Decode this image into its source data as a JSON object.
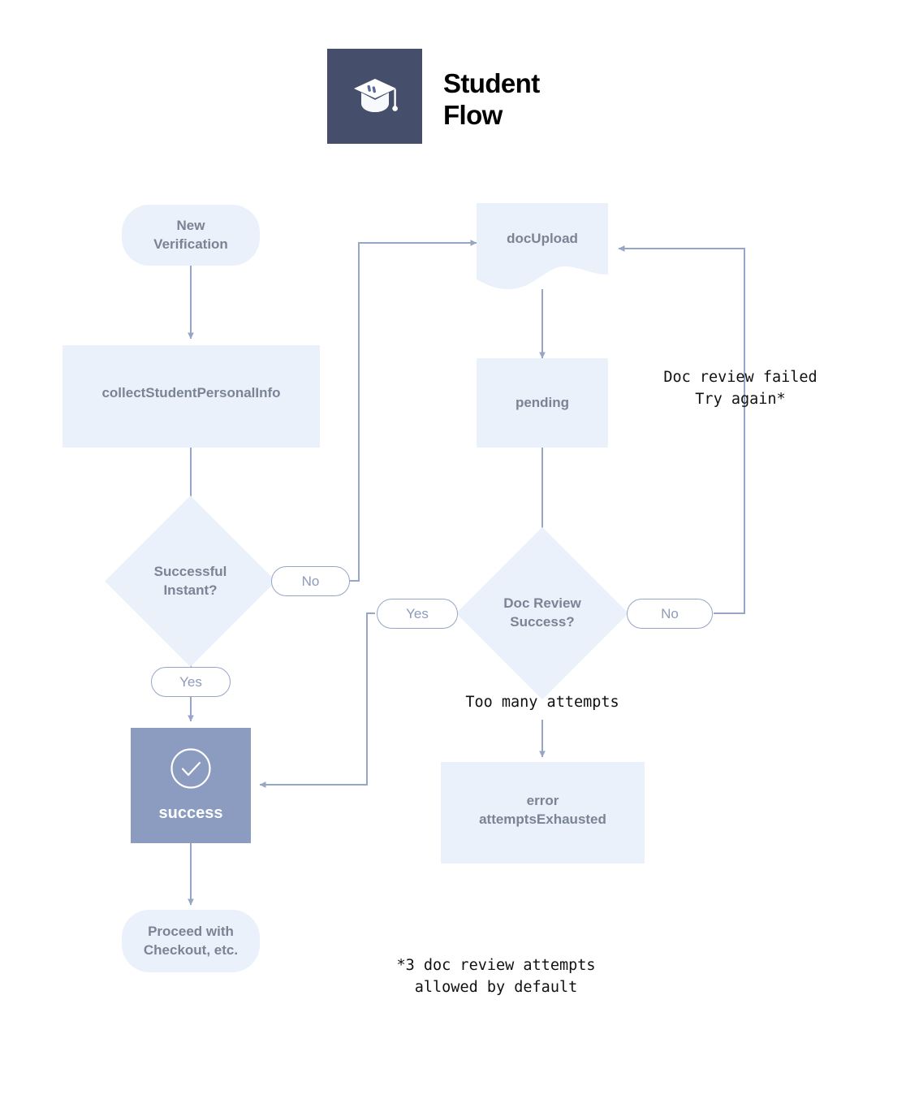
{
  "header": {
    "title": "Student\nFlow",
    "logo_icon": "graduation-cap-icon",
    "logo_bg": "#454f6b"
  },
  "colors": {
    "node_fill": "#eaf1fb",
    "node_text": "#7b8494",
    "success_fill": "#8c9cc0",
    "success_text": "#ffffff",
    "edge_stroke": "#97a5c6",
    "pill_text": "#8e9bbb",
    "annotation_text": "#111111",
    "background": "#ffffff"
  },
  "chart_data": {
    "type": "diagram",
    "title": "Student Flow",
    "nodes": [
      {
        "id": "new_verification",
        "label": "New\nVerification",
        "shape": "rounded-terminal"
      },
      {
        "id": "collect_info",
        "label": "collectStudentPersonalInfo",
        "shape": "rectangle"
      },
      {
        "id": "successful_instant",
        "label": "Successful\nInstant?",
        "shape": "diamond"
      },
      {
        "id": "success",
        "label": "success",
        "shape": "rectangle-filled",
        "icon": "check-circle-icon"
      },
      {
        "id": "proceed",
        "label": "Proceed with\nCheckout, etc.",
        "shape": "rounded-terminal"
      },
      {
        "id": "doc_upload",
        "label": "docUpload",
        "shape": "document"
      },
      {
        "id": "pending",
        "label": "pending",
        "shape": "rectangle"
      },
      {
        "id": "doc_review",
        "label": "Doc Review\nSuccess?",
        "shape": "diamond"
      },
      {
        "id": "error",
        "label": "error\nattemptsExhausted",
        "shape": "rectangle"
      }
    ],
    "edges": [
      {
        "from": "new_verification",
        "to": "collect_info",
        "label": ""
      },
      {
        "from": "collect_info",
        "to": "successful_instant",
        "label": ""
      },
      {
        "from": "successful_instant",
        "to": "success",
        "label": "Yes"
      },
      {
        "from": "successful_instant",
        "to": "doc_upload",
        "label": "No"
      },
      {
        "from": "success",
        "to": "proceed",
        "label": ""
      },
      {
        "from": "doc_upload",
        "to": "pending",
        "label": ""
      },
      {
        "from": "pending",
        "to": "doc_review",
        "label": ""
      },
      {
        "from": "doc_review",
        "to": "success",
        "label": "Yes"
      },
      {
        "from": "doc_review",
        "to": "doc_upload",
        "label": "No",
        "note": "Doc review failed\nTry again*"
      },
      {
        "from": "doc_review",
        "to": "error",
        "label": "",
        "note": "Too many attempts"
      }
    ]
  },
  "nodes": {
    "new_verification": "New\nVerification",
    "collect_info": "collectStudentPersonalInfo",
    "successful_instant": "Successful\nInstant?",
    "success": "success",
    "proceed": "Proceed with\nCheckout, etc.",
    "doc_upload": "docUpload",
    "pending": "pending",
    "doc_review": "Doc Review\nSuccess?",
    "error": "error\nattemptsExhausted"
  },
  "edge_labels": {
    "instant_no": "No",
    "instant_yes": "Yes",
    "review_yes": "Yes",
    "review_no": "No"
  },
  "annotations": {
    "doc_review_failed": "Doc review failed\nTry again*",
    "too_many_attempts": "Too many attempts",
    "footnote": "*3 doc review attempts\nallowed by default"
  }
}
